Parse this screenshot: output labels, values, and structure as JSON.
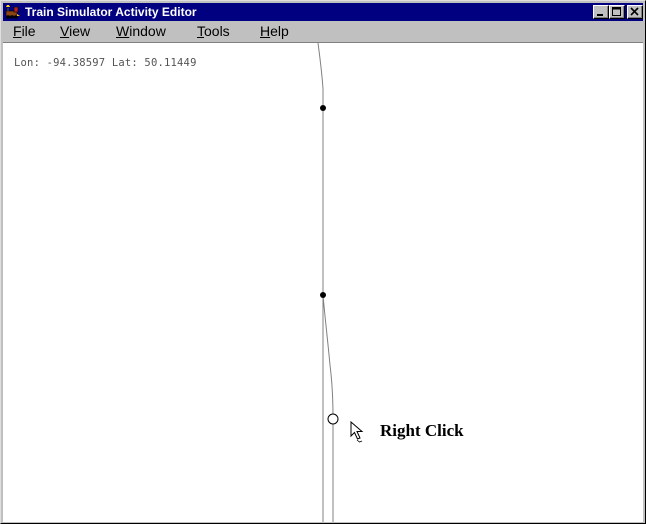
{
  "window": {
    "title": "Train Simulator Activity Editor",
    "title_bar_color": "#000080",
    "controls": [
      "minimize-icon",
      "maximize-icon",
      "close-icon"
    ]
  },
  "menu": {
    "file": "File",
    "view": "View",
    "window": "Window",
    "tools": "Tools",
    "help": "Help"
  },
  "map": {
    "coordinates": "Lon: -94.38597 Lat: 50.11449",
    "track_color": "#808080",
    "node_color": "#000000"
  },
  "annotation": {
    "label": "Right Click",
    "pointer_icon": "mouse-pointer-icon"
  }
}
